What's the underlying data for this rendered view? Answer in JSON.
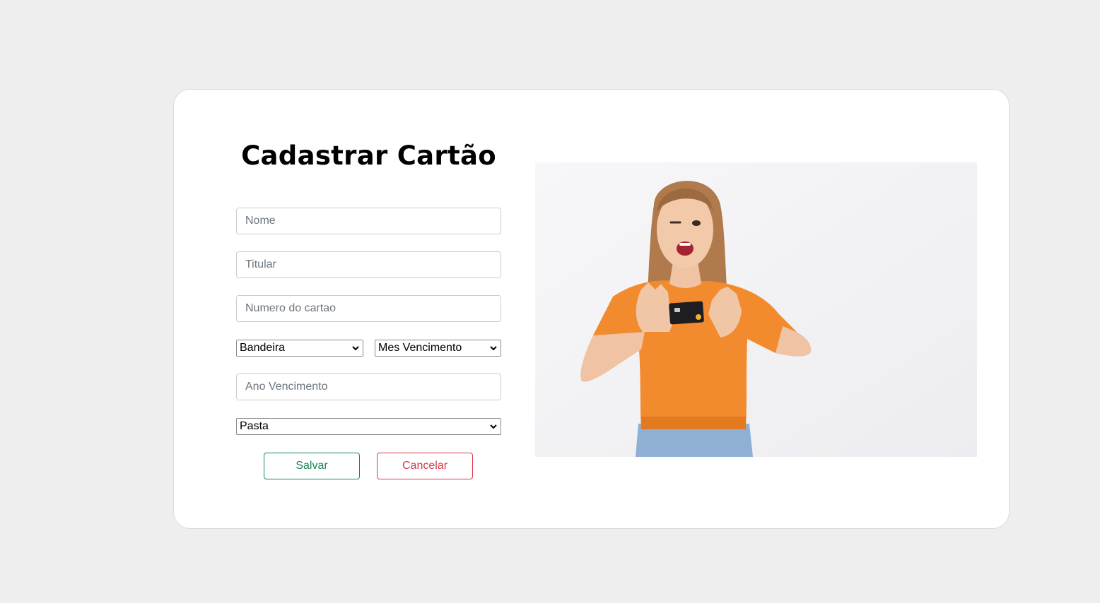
{
  "form": {
    "title": "Cadastrar Cartão",
    "nome_placeholder": "Nome",
    "titular_placeholder": "Titular",
    "numero_placeholder": "Numero do cartao",
    "bandeira_selected": "Bandeira",
    "mes_selected": "Mes Vencimento",
    "ano_placeholder": "Ano Vencimento",
    "pasta_selected": "Pasta",
    "save_label": "Salvar",
    "cancel_label": "Cancelar"
  },
  "colors": {
    "page_background": "#eeeeef",
    "save": "#198754",
    "cancel": "#dc3545",
    "shirt": "#f28a2e"
  },
  "icons": {
    "select_arrow": "chevron-down-icon"
  }
}
